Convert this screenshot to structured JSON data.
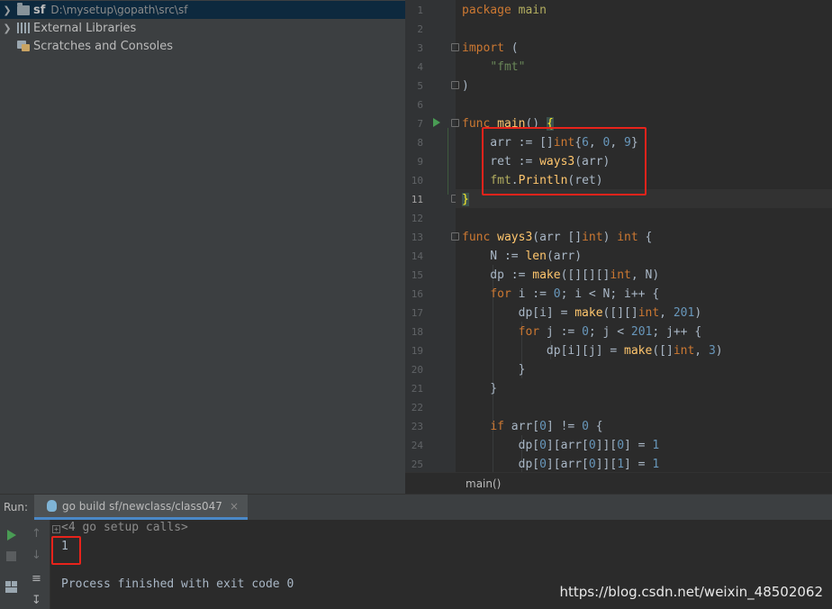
{
  "project_tree": {
    "root_name": "sf",
    "root_path": "D:\\mysetup\\gopath\\src\\sf",
    "external_libraries": "External Libraries",
    "scratches": "Scratches and Consoles"
  },
  "editor": {
    "current_line": 11,
    "lines": [
      {
        "n": "1",
        "tokens": [
          {
            "t": "package ",
            "c": "kw"
          },
          {
            "t": "main",
            "c": "pkg"
          }
        ]
      },
      {
        "n": "2",
        "tokens": []
      },
      {
        "n": "3",
        "tokens": [
          {
            "t": "import",
            "c": "kw"
          },
          {
            "t": " (",
            "c": ""
          }
        ]
      },
      {
        "n": "4",
        "tokens": [
          {
            "t": "    ",
            "c": ""
          },
          {
            "t": "\"fmt\"",
            "c": "str"
          }
        ]
      },
      {
        "n": "5",
        "tokens": [
          {
            "t": ")",
            "c": ""
          }
        ]
      },
      {
        "n": "6",
        "tokens": []
      },
      {
        "n": "7",
        "tokens": [
          {
            "t": "func ",
            "c": "kw"
          },
          {
            "t": "main",
            "c": "fn"
          },
          {
            "t": "() ",
            "c": ""
          },
          {
            "t": "{",
            "c": "brace-hl"
          }
        ]
      },
      {
        "n": "8",
        "tokens": [
          {
            "t": "    arr := []",
            "c": ""
          },
          {
            "t": "int",
            "c": "kw"
          },
          {
            "t": "{",
            "c": ""
          },
          {
            "t": "6",
            "c": "num"
          },
          {
            "t": ", ",
            "c": ""
          },
          {
            "t": "0",
            "c": "num"
          },
          {
            "t": ", ",
            "c": ""
          },
          {
            "t": "9",
            "c": "num"
          },
          {
            "t": "}",
            "c": ""
          }
        ]
      },
      {
        "n": "9",
        "tokens": [
          {
            "t": "    ret := ",
            "c": ""
          },
          {
            "t": "ways3",
            "c": "fn"
          },
          {
            "t": "(arr)",
            "c": ""
          }
        ]
      },
      {
        "n": "10",
        "tokens": [
          {
            "t": "    ",
            "c": ""
          },
          {
            "t": "fmt",
            "c": "pkg"
          },
          {
            "t": ".",
            "c": ""
          },
          {
            "t": "Println",
            "c": "fn"
          },
          {
            "t": "(ret)",
            "c": ""
          }
        ]
      },
      {
        "n": "11",
        "tokens": [
          {
            "t": "}",
            "c": "brace-hl"
          }
        ]
      },
      {
        "n": "12",
        "tokens": []
      },
      {
        "n": "13",
        "tokens": [
          {
            "t": "func ",
            "c": "kw"
          },
          {
            "t": "ways3",
            "c": "fn"
          },
          {
            "t": "(arr []",
            "c": ""
          },
          {
            "t": "int",
            "c": "kw"
          },
          {
            "t": ") ",
            "c": ""
          },
          {
            "t": "int",
            "c": "kw"
          },
          {
            "t": " {",
            "c": ""
          }
        ]
      },
      {
        "n": "14",
        "tokens": [
          {
            "t": "    N := ",
            "c": ""
          },
          {
            "t": "len",
            "c": "fn"
          },
          {
            "t": "(arr)",
            "c": ""
          }
        ]
      },
      {
        "n": "15",
        "tokens": [
          {
            "t": "    dp := ",
            "c": ""
          },
          {
            "t": "make",
            "c": "fn"
          },
          {
            "t": "([][][]",
            "c": ""
          },
          {
            "t": "int",
            "c": "kw"
          },
          {
            "t": ", N)",
            "c": ""
          }
        ]
      },
      {
        "n": "16",
        "tokens": [
          {
            "t": "    ",
            "c": ""
          },
          {
            "t": "for",
            "c": "kw"
          },
          {
            "t": " i := ",
            "c": ""
          },
          {
            "t": "0",
            "c": "num"
          },
          {
            "t": "; i < N; i++ {",
            "c": ""
          }
        ]
      },
      {
        "n": "17",
        "tokens": [
          {
            "t": "        dp[i] = ",
            "c": ""
          },
          {
            "t": "make",
            "c": "fn"
          },
          {
            "t": "([][]",
            "c": ""
          },
          {
            "t": "int",
            "c": "kw"
          },
          {
            "t": ", ",
            "c": ""
          },
          {
            "t": "201",
            "c": "num"
          },
          {
            "t": ")",
            "c": ""
          }
        ]
      },
      {
        "n": "18",
        "tokens": [
          {
            "t": "        ",
            "c": ""
          },
          {
            "t": "for",
            "c": "kw"
          },
          {
            "t": " j := ",
            "c": ""
          },
          {
            "t": "0",
            "c": "num"
          },
          {
            "t": "; j < ",
            "c": ""
          },
          {
            "t": "201",
            "c": "num"
          },
          {
            "t": "; j++ {",
            "c": ""
          }
        ]
      },
      {
        "n": "19",
        "tokens": [
          {
            "t": "            dp[i][j] = ",
            "c": ""
          },
          {
            "t": "make",
            "c": "fn"
          },
          {
            "t": "([]",
            "c": ""
          },
          {
            "t": "int",
            "c": "kw"
          },
          {
            "t": ", ",
            "c": ""
          },
          {
            "t": "3",
            "c": "num"
          },
          {
            "t": ")",
            "c": ""
          }
        ]
      },
      {
        "n": "20",
        "tokens": [
          {
            "t": "        }",
            "c": ""
          }
        ]
      },
      {
        "n": "21",
        "tokens": [
          {
            "t": "    }",
            "c": ""
          }
        ]
      },
      {
        "n": "22",
        "tokens": []
      },
      {
        "n": "23",
        "tokens": [
          {
            "t": "    ",
            "c": ""
          },
          {
            "t": "if",
            "c": "kw"
          },
          {
            "t": " arr[",
            "c": ""
          },
          {
            "t": "0",
            "c": "num"
          },
          {
            "t": "] != ",
            "c": ""
          },
          {
            "t": "0",
            "c": "num"
          },
          {
            "t": " {",
            "c": ""
          }
        ]
      },
      {
        "n": "24",
        "tokens": [
          {
            "t": "        dp[",
            "c": ""
          },
          {
            "t": "0",
            "c": "num"
          },
          {
            "t": "][arr[",
            "c": ""
          },
          {
            "t": "0",
            "c": "num"
          },
          {
            "t": "]][",
            "c": ""
          },
          {
            "t": "0",
            "c": "num"
          },
          {
            "t": "] = ",
            "c": ""
          },
          {
            "t": "1",
            "c": "num"
          }
        ]
      },
      {
        "n": "25",
        "tokens": [
          {
            "t": "        dp[",
            "c": ""
          },
          {
            "t": "0",
            "c": "num"
          },
          {
            "t": "][arr[",
            "c": ""
          },
          {
            "t": "0",
            "c": "num"
          },
          {
            "t": "]][",
            "c": ""
          },
          {
            "t": "1",
            "c": "num"
          },
          {
            "t": "] = ",
            "c": ""
          },
          {
            "t": "1",
            "c": "num"
          }
        ]
      }
    ],
    "breadcrumb": "main()"
  },
  "run_panel": {
    "label": "Run:",
    "tab_title": "go build sf/newclass/class047",
    "tab_close": "×",
    "console": {
      "setup_calls": "<4 go setup calls>",
      "output": "1",
      "finished": "Process finished with exit code 0"
    }
  },
  "watermark": "https://blog.csdn.net/weixin_48502062",
  "colors": {
    "highlight_box": "#e8231b",
    "run_green": "#499c54",
    "accent_blue": "#4a88c7"
  }
}
